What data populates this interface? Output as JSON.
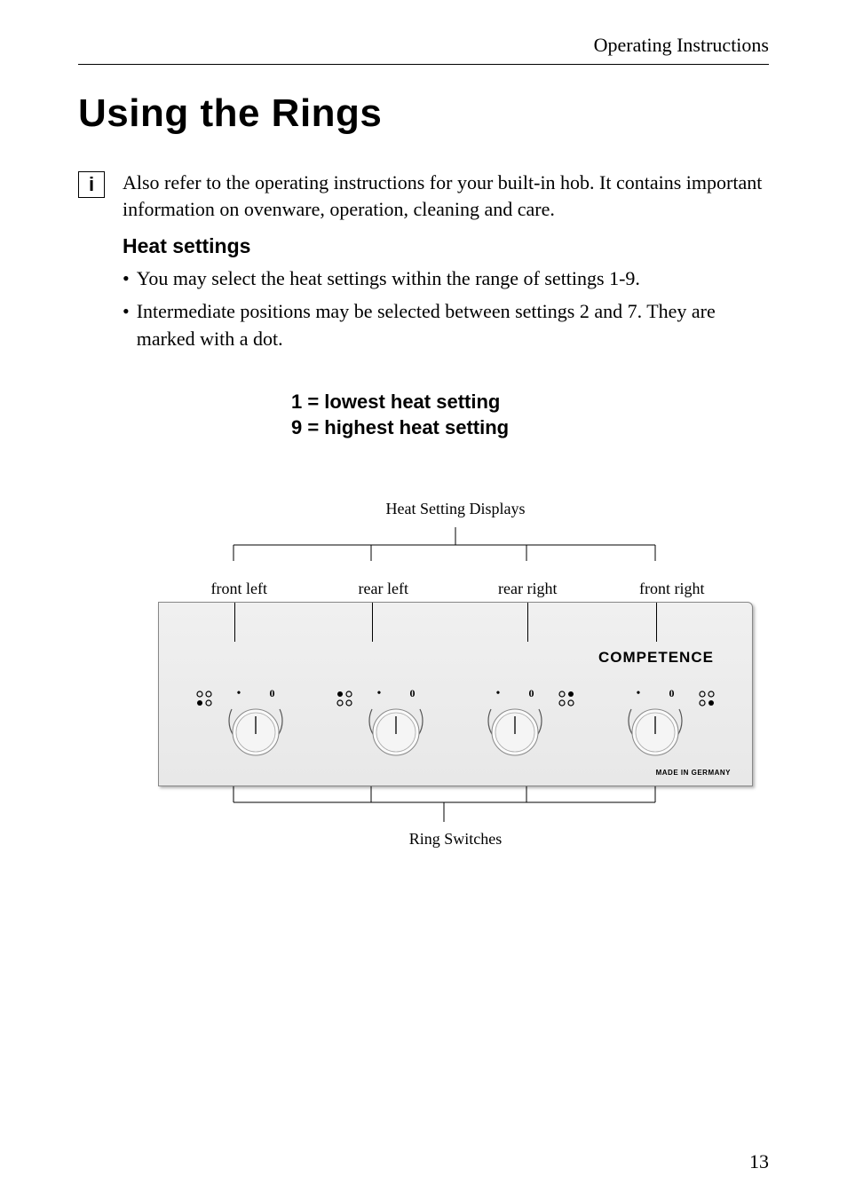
{
  "header": {
    "section": "Operating Instructions"
  },
  "heading": "Using the Rings",
  "info": {
    "icon_label": "i",
    "text": "Also refer to the operating instructions for your built-in hob. It contains important information on ovenware, operation, cleaning and care."
  },
  "heat_settings": {
    "heading": "Heat settings",
    "bullets": [
      "You may select the heat settings within the range of settings 1-9.",
      "Intermediate positions may be selected between settings 2 and 7. They are marked with a dot."
    ],
    "legend_line1": "1 = lowest heat setting",
    "legend_line2": "9 = highest heat setting"
  },
  "diagram": {
    "top_label": "Heat Setting Displays",
    "positions": {
      "front_left": "front left",
      "rear_left": "rear left",
      "rear_right": "rear right",
      "front_right": "front right"
    },
    "brand": "COMPETENCE",
    "made_in": "MADE IN GERMANY",
    "bottom_label": "Ring Switches",
    "knob_zero": "0"
  },
  "page_number": "13"
}
